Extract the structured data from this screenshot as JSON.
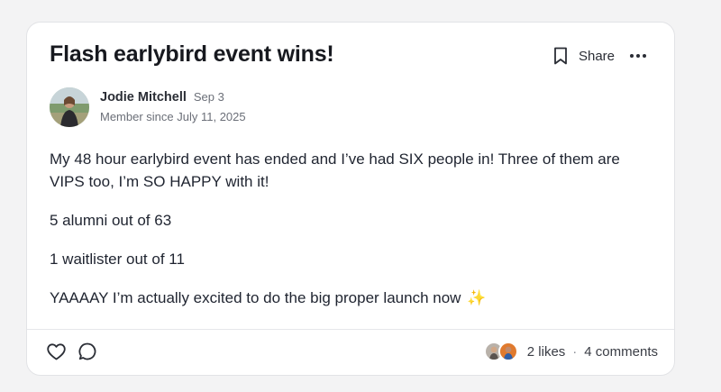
{
  "post": {
    "title": "Flash earlybird event wins!",
    "author": {
      "name": "Jodie Mitchell",
      "date": "Sep 3",
      "member_since": "Member since July 11, 2025"
    },
    "body": [
      "My 48 hour earlybird event has ended and I’ve had SIX people in! Three of them are VIPS too, I’m SO HAPPY with it!",
      "5 alumni out of 63",
      "1 waitlister out of 11",
      "YAAAAY I’m actually excited to do the big proper launch now"
    ],
    "emoji": "✨"
  },
  "actions": {
    "bookmark_icon": "bookmark-icon",
    "share_label": "Share",
    "more_icon": "more-horizontal-icon"
  },
  "footer": {
    "like_icon": "heart-icon",
    "comment_icon": "comment-icon",
    "likes": "2 likes",
    "separator": "·",
    "comments": "4 comments"
  },
  "colors": {
    "background": "#f3f3f4",
    "card": "#ffffff",
    "title": "#17191f",
    "muted": "#6b6f78"
  }
}
